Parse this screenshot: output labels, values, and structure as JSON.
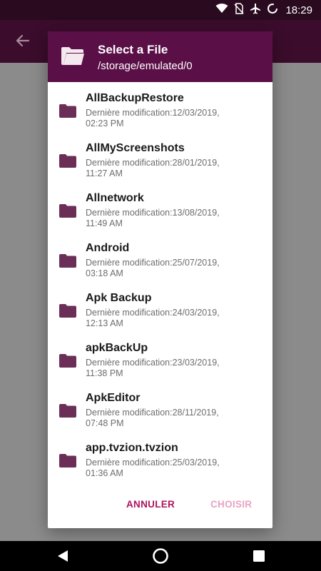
{
  "status_bar": {
    "time": "18:29",
    "icons": [
      "wifi-icon",
      "no-sim-icon",
      "airplane-icon",
      "battery-loading-icon"
    ]
  },
  "app_bar": {
    "back_icon": "back-arrow-icon"
  },
  "dialog": {
    "title": "Select a File",
    "path": "/storage/emulated/0",
    "header_icon": "folder-open-icon",
    "items": [
      {
        "name": "AllBackupRestore",
        "modified": "Dernière modification:12/03/2019, 02:23 PM"
      },
      {
        "name": "AllMyScreenshots",
        "modified": "Dernière modification:28/01/2019, 11:27 AM"
      },
      {
        "name": "Allnetwork",
        "modified": "Dernière modification:13/08/2019, 11:49 AM"
      },
      {
        "name": "Android",
        "modified": "Dernière modification:25/07/2019, 03:18 AM"
      },
      {
        "name": "Apk Backup",
        "modified": "Dernière modification:24/03/2019, 12:13 AM"
      },
      {
        "name": "apkBackUp",
        "modified": "Dernière modification:23/03/2019, 11:38 PM"
      },
      {
        "name": "ApkEditor",
        "modified": "Dernière modification:28/11/2019, 07:48 PM"
      },
      {
        "name": "app.tvzion.tvzion",
        "modified": "Dernière modification:25/03/2019, 01:36 AM"
      }
    ],
    "cancel_label": "ANNULER",
    "choose_label": "CHOISIR"
  },
  "colors": {
    "status_bar": "#2a0a1f",
    "app_bar": "#3b0c2c",
    "dialog_header": "#5b0f47",
    "folder": "#6b2e57",
    "cancel": "#b0125e",
    "choose_disabled": "#e8a3c2"
  },
  "nav_bar": {
    "icons": [
      "back-triangle-icon",
      "home-circle-icon",
      "recents-square-icon"
    ]
  }
}
